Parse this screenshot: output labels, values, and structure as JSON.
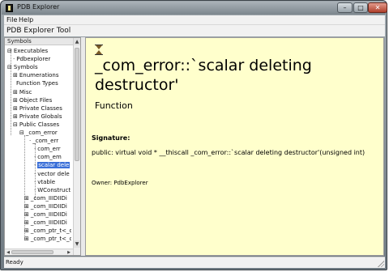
{
  "window": {
    "title": "PDB Explorer",
    "minimize_glyph": "–",
    "maximize_glyph": "□",
    "close_glyph": "✕"
  },
  "menu": {
    "file": "File",
    "help": "Help"
  },
  "toolbar": {
    "label": "PDB Explorer Tool"
  },
  "tree": {
    "title": "Symbols",
    "scroll_up": "▲",
    "scroll_down": "▼",
    "scroll_left": "◀",
    "scroll_right": "▶",
    "rows": [
      {
        "label": "Executables",
        "prefix": "⊟",
        "selected": false
      },
      {
        "label": "Pdbexplorer",
        "prefix": "·",
        "selected": false
      },
      {
        "label": "Symbols",
        "prefix": "⊟",
        "selected": false
      },
      {
        "label": "Enumerations",
        "prefix": "⊞",
        "selected": false
      },
      {
        "label": "Function Types",
        "prefix": "",
        "selected": false
      },
      {
        "label": "Misc",
        "prefix": "⊞",
        "selected": false
      },
      {
        "label": "Object Files",
        "prefix": "⊞",
        "selected": false
      },
      {
        "label": "Private Classes",
        "prefix": "⊞",
        "selected": false
      },
      {
        "label": "Private Globals",
        "prefix": "⊞",
        "selected": false
      },
      {
        "label": "Public Classes",
        "prefix": "⊟",
        "selected": false
      },
      {
        "label": "_com_error",
        "prefix": "⊟",
        "selected": false
      },
      {
        "label": "_com_err",
        "prefix": "·",
        "selected": false
      },
      {
        "label": "com_err",
        "prefix": "·",
        "selected": false
      },
      {
        "label": "com_em",
        "prefix": "·",
        "selected": false
      },
      {
        "label": "scalar dele",
        "prefix": "·",
        "selected": true
      },
      {
        "label": "vector dele",
        "prefix": "·",
        "selected": false
      },
      {
        "label": "vtable",
        "prefix": "·",
        "selected": false
      },
      {
        "label": "WConstruct",
        "prefix": "·",
        "selected": false
      },
      {
        "label": "_com_IIIDIIDi",
        "prefix": "⊞",
        "selected": false
      },
      {
        "label": "_com_IIIDIIDi",
        "prefix": "⊞",
        "selected": false
      },
      {
        "label": "_com_IIIDIIDi",
        "prefix": "⊞",
        "selected": false
      },
      {
        "label": "_com_IIIDIIDi",
        "prefix": "⊞",
        "selected": false
      },
      {
        "label": "_com_ptr_t<_c",
        "prefix": "⊞",
        "selected": false
      },
      {
        "label": "_com_ptr_t<_c",
        "prefix": "⊞",
        "selected": false
      }
    ]
  },
  "content": {
    "heading": "_com_error::`scalar deleting destructor'",
    "kind": "Function",
    "signature_label": "Signature:",
    "signature": "public: virtual void * __thiscall _com_error::`scalar deleting destructor'(unsigned int)",
    "owner": "Owner: PdbExplorer"
  },
  "status": {
    "text": "Ready"
  }
}
